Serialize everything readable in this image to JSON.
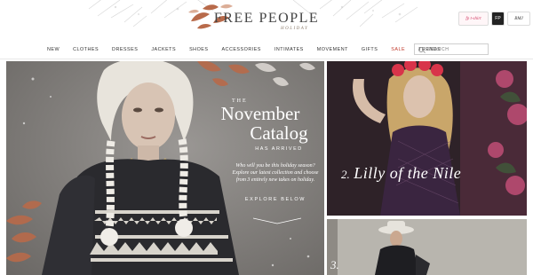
{
  "header": {
    "logo": "FREE PEOPLE",
    "logo_sub": "Holiday",
    "promos": {
      "fp_label": "fp t-shirt",
      "icon_label": "FP",
      "bmj_label": "BMJ"
    }
  },
  "nav": {
    "items": [
      "New",
      "Clothes",
      "Dresses",
      "Jackets",
      "Shoes",
      "Accessories",
      "Intimates",
      "Movement",
      "Gifts",
      "Sale",
      "Trends"
    ],
    "search_placeholder": "SEARCH"
  },
  "hero": {
    "the": "THE",
    "title_line1": "November",
    "title_line2": "Catalog",
    "subtitle": "HAS ARRIVED",
    "body": "Who will you be this holiday season? Explore our latest collection and choose from 3 entirely new takes on holiday.",
    "cta": "EXPLORE BELOW"
  },
  "panel2": {
    "number": "2.",
    "title": "Lilly of the Nile"
  },
  "panel3": {
    "number": "3."
  },
  "colors": {
    "sale": "#c0392b",
    "accent_copper": "#b86a4a",
    "hero_bg": "#8a8784"
  }
}
